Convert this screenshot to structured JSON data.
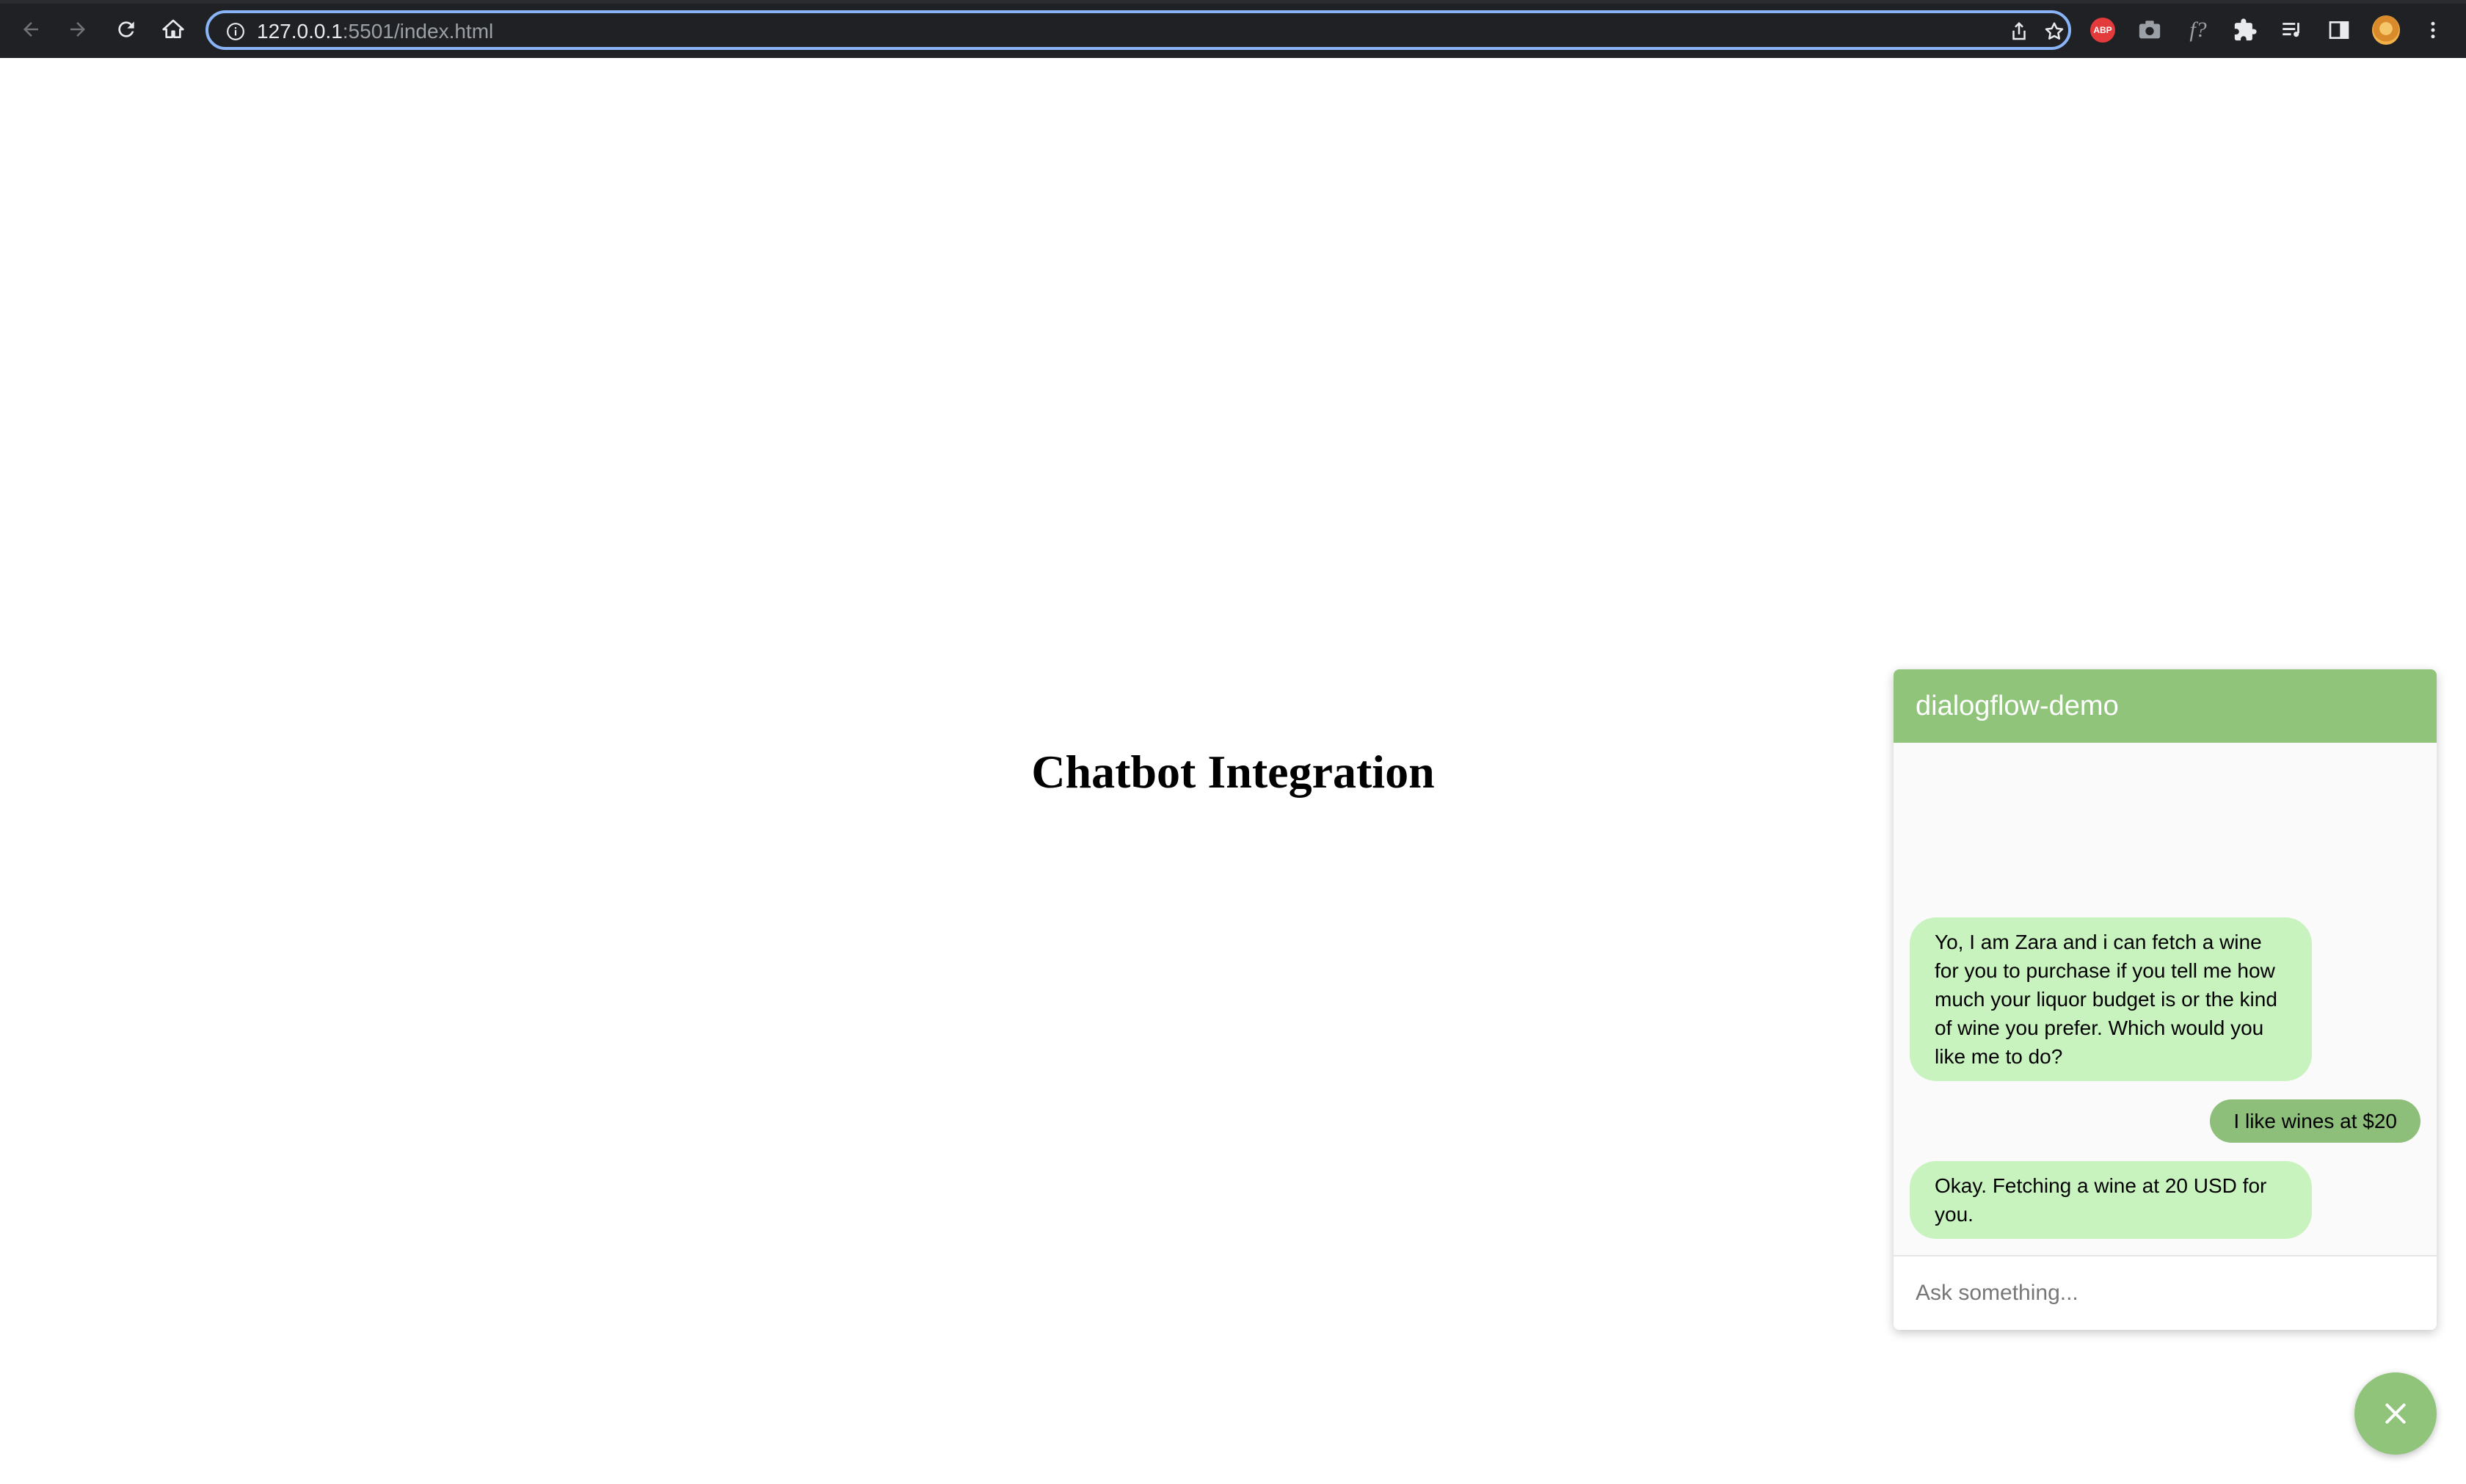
{
  "browser": {
    "url_host": "127.0.0.1",
    "url_rest": ":5501/index.html",
    "extensions": {
      "abp_label": "ABP",
      "fx_label": "f?"
    }
  },
  "page": {
    "title": "Chatbot Integration"
  },
  "chat": {
    "title": "dialogflow-demo",
    "messages": [
      {
        "from": "bot",
        "text": "Yo, I am Zara and i can fetch a wine for you to purchase if you tell me how much your liquor budget is or the kind of wine you prefer. Which would you like me to do?"
      },
      {
        "from": "user",
        "text": "I like wines at $20"
      },
      {
        "from": "bot",
        "text": "Okay. Fetching a wine at 20 USD for you."
      }
    ],
    "input_placeholder": "Ask something...",
    "input_value": ""
  },
  "colors": {
    "header": "#8fc47a",
    "bot_bubble": "#c8f3bf",
    "user_bubble": "#8dbf7b",
    "fab": "#8fc47a"
  },
  "icons": {
    "fab": "close-icon"
  }
}
